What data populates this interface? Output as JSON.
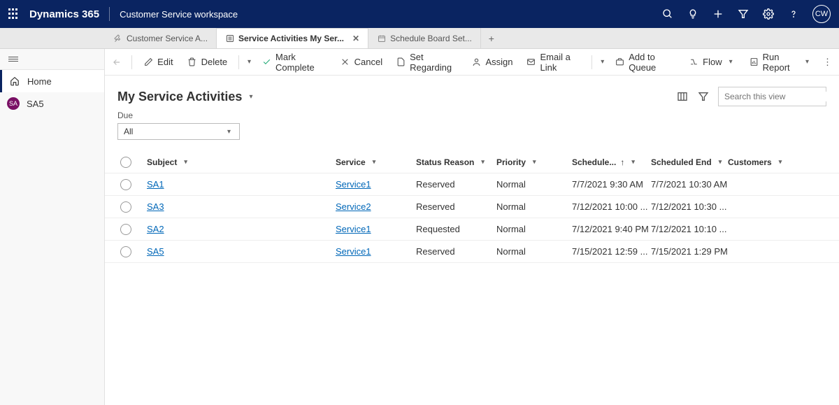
{
  "topbar": {
    "brand": "Dynamics 365",
    "workspace": "Customer Service workspace",
    "user_initials": "CW"
  },
  "tabs": {
    "0": {
      "label": "Customer Service A..."
    },
    "1": {
      "label": "Service Activities My Ser..."
    },
    "2": {
      "label": "Schedule Board Set..."
    }
  },
  "sidebar": {
    "home": "Home",
    "sa_badge": "SA",
    "sa_label": "SA5"
  },
  "commands": {
    "edit": "Edit",
    "delete": "Delete",
    "mark_complete": "Mark Complete",
    "cancel": "Cancel",
    "set_regarding": "Set Regarding",
    "assign": "Assign",
    "email_link": "Email a Link",
    "add_queue": "Add to Queue",
    "flow": "Flow",
    "run_report": "Run Report"
  },
  "view": {
    "title": "My Service Activities",
    "search_placeholder": "Search this view"
  },
  "filter": {
    "label": "Due",
    "value": "All"
  },
  "columns": {
    "subject": "Subject",
    "service": "Service",
    "status": "Status Reason",
    "priority": "Priority",
    "start": "Schedule...",
    "end": "Scheduled End",
    "customers": "Customers"
  },
  "rows": [
    {
      "subject": "SA1",
      "service": "Service1",
      "status": "Reserved",
      "priority": "Normal",
      "start": "7/7/2021 9:30 AM",
      "end": "7/7/2021 10:30 AM",
      "customers": ""
    },
    {
      "subject": "SA3",
      "service": "Service2",
      "status": "Reserved",
      "priority": "Normal",
      "start": "7/12/2021 10:00 ...",
      "end": "7/12/2021 10:30 ...",
      "customers": ""
    },
    {
      "subject": "SA2",
      "service": "Service1",
      "status": "Requested",
      "priority": "Normal",
      "start": "7/12/2021 9:40 PM",
      "end": "7/12/2021 10:10 ...",
      "customers": ""
    },
    {
      "subject": "SA5",
      "service": "Service1",
      "status": "Reserved",
      "priority": "Normal",
      "start": "7/15/2021 12:59 ...",
      "end": "7/15/2021 1:29 PM",
      "customers": ""
    }
  ]
}
